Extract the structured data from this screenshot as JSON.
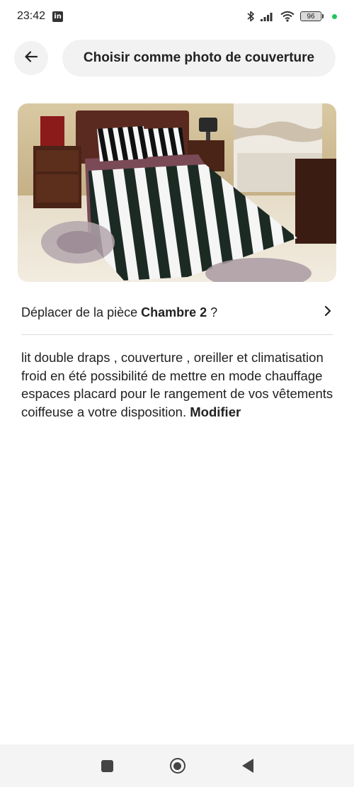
{
  "status_bar": {
    "time": "23:42",
    "app_badge": "in",
    "battery_level": "96",
    "battery_fraction": 0.96,
    "notification_dot_color": "#22c55e"
  },
  "header": {
    "back_icon": "arrow-left-icon",
    "cover_button_label": "Choisir comme photo de couverture"
  },
  "photo": {
    "icon": "bedroom-photo"
  },
  "move_row": {
    "prefix": "Déplacer de la pièce ",
    "room": "Chambre 2",
    "suffix": " ?",
    "chevron_icon": "chevron-right-icon"
  },
  "description": {
    "text": "lit double  draps , couverture , oreiller et climatisation froid en été possibilité de mettre en mode chauffage espaces placard pour le rangement de vos vêtements coiffeuse a votre disposition. ",
    "modify_label": "Modifier"
  },
  "nav_bar": {
    "recents_icon": "square-icon",
    "home_icon": "circle-icon",
    "back_icon": "triangle-back-icon"
  }
}
